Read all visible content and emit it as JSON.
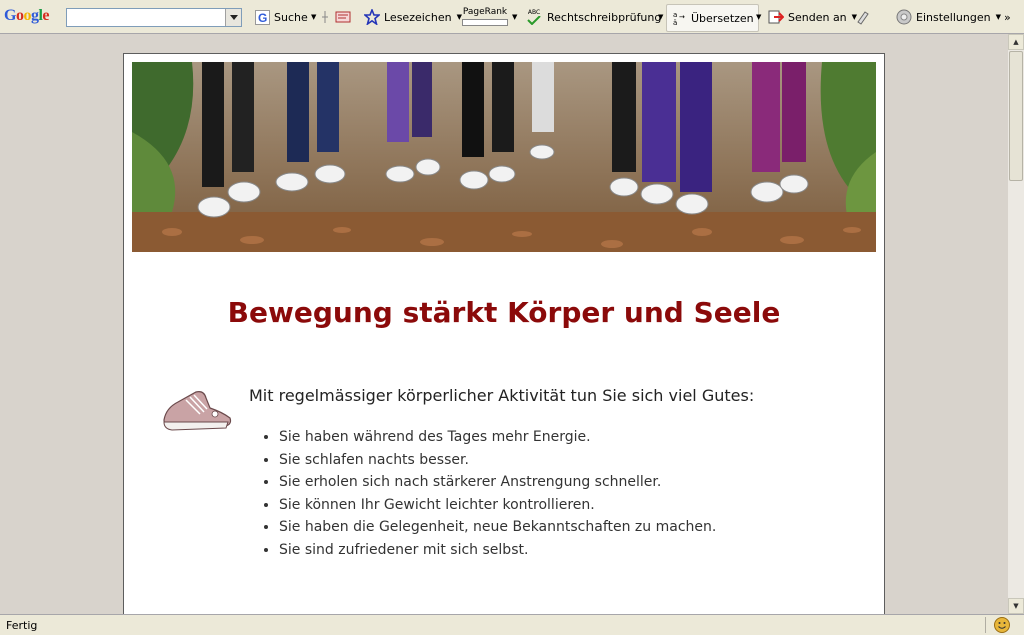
{
  "toolbar": {
    "logo": {
      "letters": [
        "G",
        "o",
        "o",
        "g",
        "l",
        "e"
      ]
    },
    "search": {
      "value": "",
      "placeholder": ""
    },
    "suche_label": "Suche",
    "lesezeichen_label": "Lesezeichen",
    "pagerank_label": "PageRank",
    "spellcheck_abc": "ABC",
    "spellcheck_label": "Rechtschreibprüfung",
    "translate_label": "Übersetzen",
    "send_label": "Senden an",
    "settings_label": "Einstellungen",
    "more_label": "»"
  },
  "page": {
    "headline": "Bewegung stärkt Körper und Seele",
    "intro": "Mit regelmässiger körperlicher Aktivität tun Sie sich viel Gutes:",
    "benefits": [
      "Sie haben während des Tages mehr Energie.",
      "Sie schlafen nachts besser.",
      "Sie erholen sich nach stärkerer Anstrengung schneller.",
      "Sie können Ihr Gewicht leichter kontrollieren.",
      "Sie haben die Gelegenheit, neue Bekanntschaften zu machen.",
      "Sie sind zufriedener mit sich selbst."
    ],
    "headline_color": "#8b0a0a"
  },
  "status": {
    "text": "Fertig"
  },
  "icons": {
    "search": "google-g-icon",
    "bookmark": "star-icon",
    "spellcheck": "check-icon",
    "translate": "translate-icon",
    "send": "send-icon",
    "settings": "gear-icon",
    "shoe": "sneaker-icon"
  }
}
